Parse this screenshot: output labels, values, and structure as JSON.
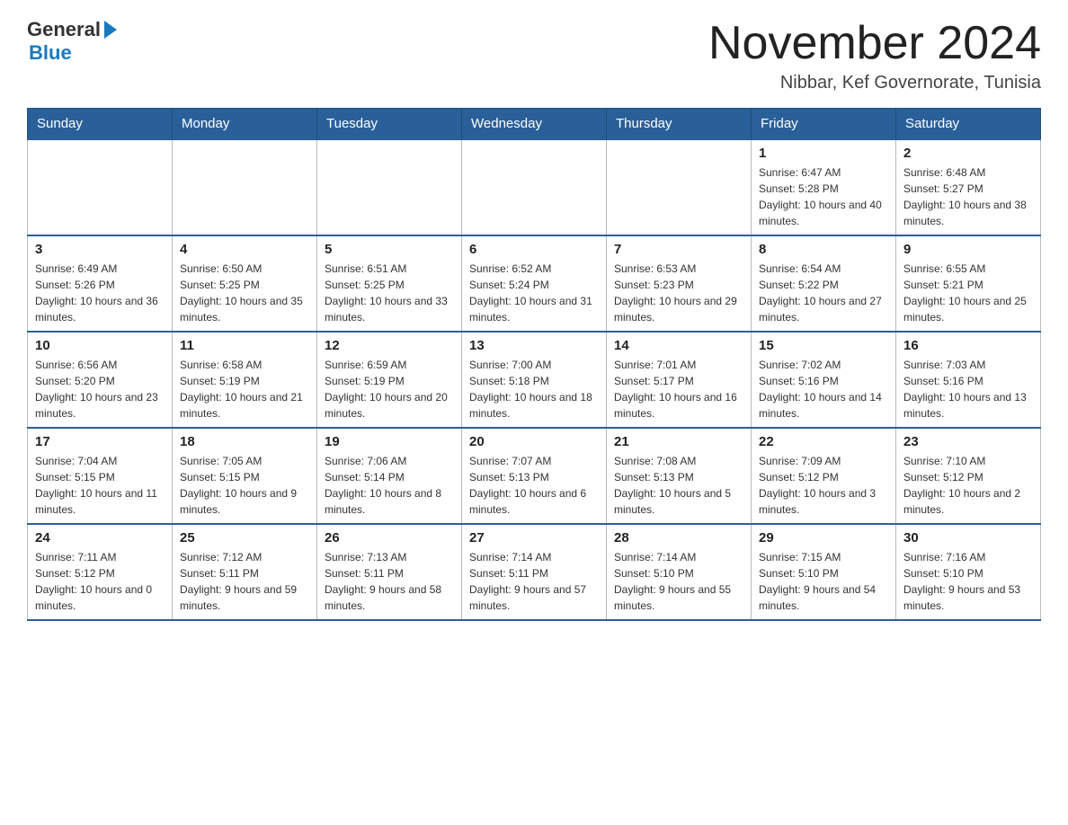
{
  "header": {
    "logo_text_general": "General",
    "logo_text_blue": "Blue",
    "month_title": "November 2024",
    "location": "Nibbar, Kef Governorate, Tunisia"
  },
  "days_of_week": [
    "Sunday",
    "Monday",
    "Tuesday",
    "Wednesday",
    "Thursday",
    "Friday",
    "Saturday"
  ],
  "weeks": [
    [
      {
        "day": "",
        "info": ""
      },
      {
        "day": "",
        "info": ""
      },
      {
        "day": "",
        "info": ""
      },
      {
        "day": "",
        "info": ""
      },
      {
        "day": "",
        "info": ""
      },
      {
        "day": "1",
        "info": "Sunrise: 6:47 AM\nSunset: 5:28 PM\nDaylight: 10 hours and 40 minutes."
      },
      {
        "day": "2",
        "info": "Sunrise: 6:48 AM\nSunset: 5:27 PM\nDaylight: 10 hours and 38 minutes."
      }
    ],
    [
      {
        "day": "3",
        "info": "Sunrise: 6:49 AM\nSunset: 5:26 PM\nDaylight: 10 hours and 36 minutes."
      },
      {
        "day": "4",
        "info": "Sunrise: 6:50 AM\nSunset: 5:25 PM\nDaylight: 10 hours and 35 minutes."
      },
      {
        "day": "5",
        "info": "Sunrise: 6:51 AM\nSunset: 5:25 PM\nDaylight: 10 hours and 33 minutes."
      },
      {
        "day": "6",
        "info": "Sunrise: 6:52 AM\nSunset: 5:24 PM\nDaylight: 10 hours and 31 minutes."
      },
      {
        "day": "7",
        "info": "Sunrise: 6:53 AM\nSunset: 5:23 PM\nDaylight: 10 hours and 29 minutes."
      },
      {
        "day": "8",
        "info": "Sunrise: 6:54 AM\nSunset: 5:22 PM\nDaylight: 10 hours and 27 minutes."
      },
      {
        "day": "9",
        "info": "Sunrise: 6:55 AM\nSunset: 5:21 PM\nDaylight: 10 hours and 25 minutes."
      }
    ],
    [
      {
        "day": "10",
        "info": "Sunrise: 6:56 AM\nSunset: 5:20 PM\nDaylight: 10 hours and 23 minutes."
      },
      {
        "day": "11",
        "info": "Sunrise: 6:58 AM\nSunset: 5:19 PM\nDaylight: 10 hours and 21 minutes."
      },
      {
        "day": "12",
        "info": "Sunrise: 6:59 AM\nSunset: 5:19 PM\nDaylight: 10 hours and 20 minutes."
      },
      {
        "day": "13",
        "info": "Sunrise: 7:00 AM\nSunset: 5:18 PM\nDaylight: 10 hours and 18 minutes."
      },
      {
        "day": "14",
        "info": "Sunrise: 7:01 AM\nSunset: 5:17 PM\nDaylight: 10 hours and 16 minutes."
      },
      {
        "day": "15",
        "info": "Sunrise: 7:02 AM\nSunset: 5:16 PM\nDaylight: 10 hours and 14 minutes."
      },
      {
        "day": "16",
        "info": "Sunrise: 7:03 AM\nSunset: 5:16 PM\nDaylight: 10 hours and 13 minutes."
      }
    ],
    [
      {
        "day": "17",
        "info": "Sunrise: 7:04 AM\nSunset: 5:15 PM\nDaylight: 10 hours and 11 minutes."
      },
      {
        "day": "18",
        "info": "Sunrise: 7:05 AM\nSunset: 5:15 PM\nDaylight: 10 hours and 9 minutes."
      },
      {
        "day": "19",
        "info": "Sunrise: 7:06 AM\nSunset: 5:14 PM\nDaylight: 10 hours and 8 minutes."
      },
      {
        "day": "20",
        "info": "Sunrise: 7:07 AM\nSunset: 5:13 PM\nDaylight: 10 hours and 6 minutes."
      },
      {
        "day": "21",
        "info": "Sunrise: 7:08 AM\nSunset: 5:13 PM\nDaylight: 10 hours and 5 minutes."
      },
      {
        "day": "22",
        "info": "Sunrise: 7:09 AM\nSunset: 5:12 PM\nDaylight: 10 hours and 3 minutes."
      },
      {
        "day": "23",
        "info": "Sunrise: 7:10 AM\nSunset: 5:12 PM\nDaylight: 10 hours and 2 minutes."
      }
    ],
    [
      {
        "day": "24",
        "info": "Sunrise: 7:11 AM\nSunset: 5:12 PM\nDaylight: 10 hours and 0 minutes."
      },
      {
        "day": "25",
        "info": "Sunrise: 7:12 AM\nSunset: 5:11 PM\nDaylight: 9 hours and 59 minutes."
      },
      {
        "day": "26",
        "info": "Sunrise: 7:13 AM\nSunset: 5:11 PM\nDaylight: 9 hours and 58 minutes."
      },
      {
        "day": "27",
        "info": "Sunrise: 7:14 AM\nSunset: 5:11 PM\nDaylight: 9 hours and 57 minutes."
      },
      {
        "day": "28",
        "info": "Sunrise: 7:14 AM\nSunset: 5:10 PM\nDaylight: 9 hours and 55 minutes."
      },
      {
        "day": "29",
        "info": "Sunrise: 7:15 AM\nSunset: 5:10 PM\nDaylight: 9 hours and 54 minutes."
      },
      {
        "day": "30",
        "info": "Sunrise: 7:16 AM\nSunset: 5:10 PM\nDaylight: 9 hours and 53 minutes."
      }
    ]
  ]
}
